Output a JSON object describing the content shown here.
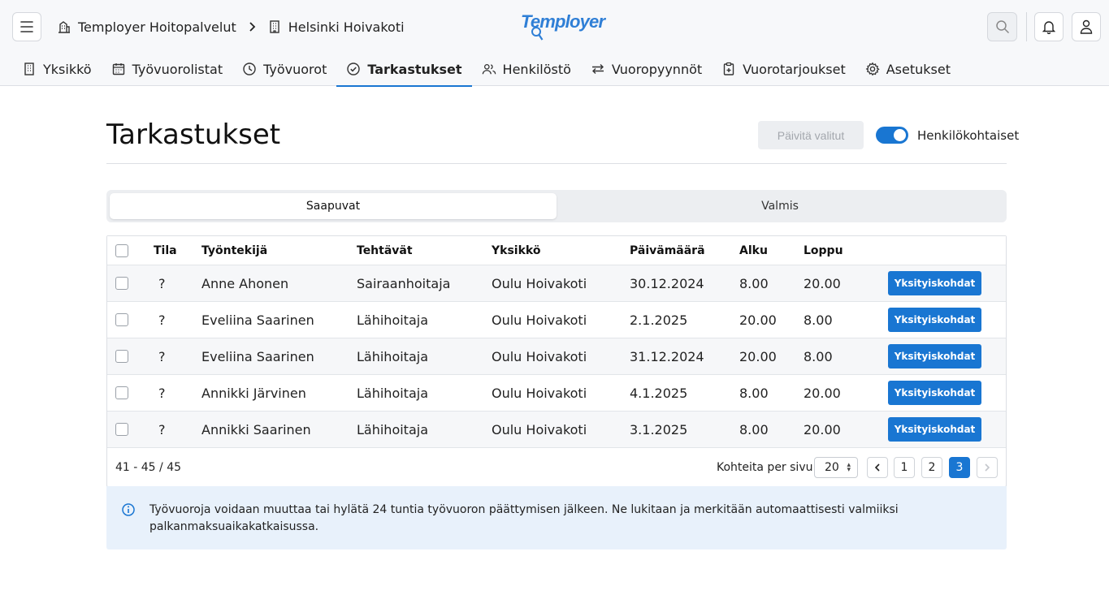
{
  "header": {
    "breadcrumb": [
      "Temployer Hoitopalvelut",
      "Helsinki Hoivakoti"
    ],
    "logo_text": "Temployer"
  },
  "nav": [
    {
      "label": "Yksikkö",
      "icon": "building-icon"
    },
    {
      "label": "Työvuorolistat",
      "icon": "calendar-icon"
    },
    {
      "label": "Työvuorot",
      "icon": "clock-icon"
    },
    {
      "label": "Tarkastukset",
      "icon": "check-circle-icon",
      "active": true
    },
    {
      "label": "Henkilöstö",
      "icon": "people-icon"
    },
    {
      "label": "Vuoropyynnöt",
      "icon": "swap-icon"
    },
    {
      "label": "Vuorotarjoukset",
      "icon": "clipboard-icon"
    },
    {
      "label": "Asetukset",
      "icon": "gear-icon"
    }
  ],
  "page": {
    "title": "Tarkastukset",
    "update_button": "Päivitä valitut",
    "toggle_label": "Henkilökohtaiset",
    "toggle_on": true
  },
  "tabs": [
    "Saapuvat",
    "Valmis"
  ],
  "table": {
    "columns": [
      "Tila",
      "Työntekijä",
      "Tehtävät",
      "Yksikkö",
      "Päivämäärä",
      "Alku",
      "Loppu"
    ],
    "rows": [
      {
        "status": "?",
        "employee": "Anne Ahonen",
        "task": "Sairaanhoitaja",
        "unit": "Oulu Hoivakoti",
        "date": "30.12.2024",
        "start": "8.00",
        "end": "20.00",
        "action": "Yksityiskohdat"
      },
      {
        "status": "?",
        "employee": "Eveliina Saarinen",
        "task": "Lähihoitaja",
        "unit": "Oulu Hoivakoti",
        "date": "2.1.2025",
        "start": "20.00",
        "end": "8.00",
        "action": "Yksityiskohdat"
      },
      {
        "status": "?",
        "employee": "Eveliina Saarinen",
        "task": "Lähihoitaja",
        "unit": "Oulu Hoivakoti",
        "date": "31.12.2024",
        "start": "20.00",
        "end": "8.00",
        "action": "Yksityiskohdat"
      },
      {
        "status": "?",
        "employee": "Annikki Järvinen",
        "task": "Lähihoitaja",
        "unit": "Oulu Hoivakoti",
        "date": "4.1.2025",
        "start": "8.00",
        "end": "20.00",
        "action": "Yksityiskohdat"
      },
      {
        "status": "?",
        "employee": "Annikki Saarinen",
        "task": "Lähihoitaja",
        "unit": "Oulu Hoivakoti",
        "date": "3.1.2025",
        "start": "8.00",
        "end": "20.00",
        "action": "Yksityiskohdat"
      }
    ]
  },
  "pagination": {
    "range": "41 - 45 / 45",
    "per_page_label": "Kohteita per sivu",
    "per_page_value": "20",
    "pages": [
      "1",
      "2",
      "3"
    ],
    "current_page": "3"
  },
  "info": {
    "text": "Työvuoroja voidaan muuttaa tai hylätä 24 tuntia työvuoron päättymisen jälkeen. Ne lukitaan ja merkitään automaattisesti valmiiksi palkanmaksuaikakatkaisussa."
  },
  "colors": {
    "accent": "#1976d2",
    "info_bg": "#e8f1fb"
  }
}
